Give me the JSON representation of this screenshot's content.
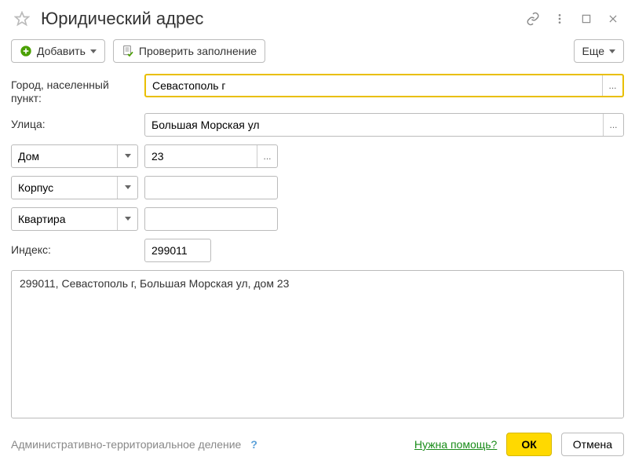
{
  "title": "Юридический адрес",
  "toolbar": {
    "add": "Добавить",
    "check": "Проверить заполнение",
    "more": "Еще"
  },
  "labels": {
    "city": "Город, населенный пункт:",
    "street": "Улица:",
    "house_type": "Дом",
    "building_type": "Корпус",
    "apartment_type": "Квартира",
    "zip": "Индекс:"
  },
  "values": {
    "city": "Севастополь г",
    "street": "Большая Морская ул",
    "house": "23",
    "building": "",
    "apartment": "",
    "zip": "299011",
    "summary": "299011, Севастополь г, Большая Морская ул, дом 23"
  },
  "footer": {
    "admin_division": "Административно-территориальное деление",
    "need_help": "Нужна помощь?",
    "ok": "ОК",
    "cancel": "Отмена"
  }
}
